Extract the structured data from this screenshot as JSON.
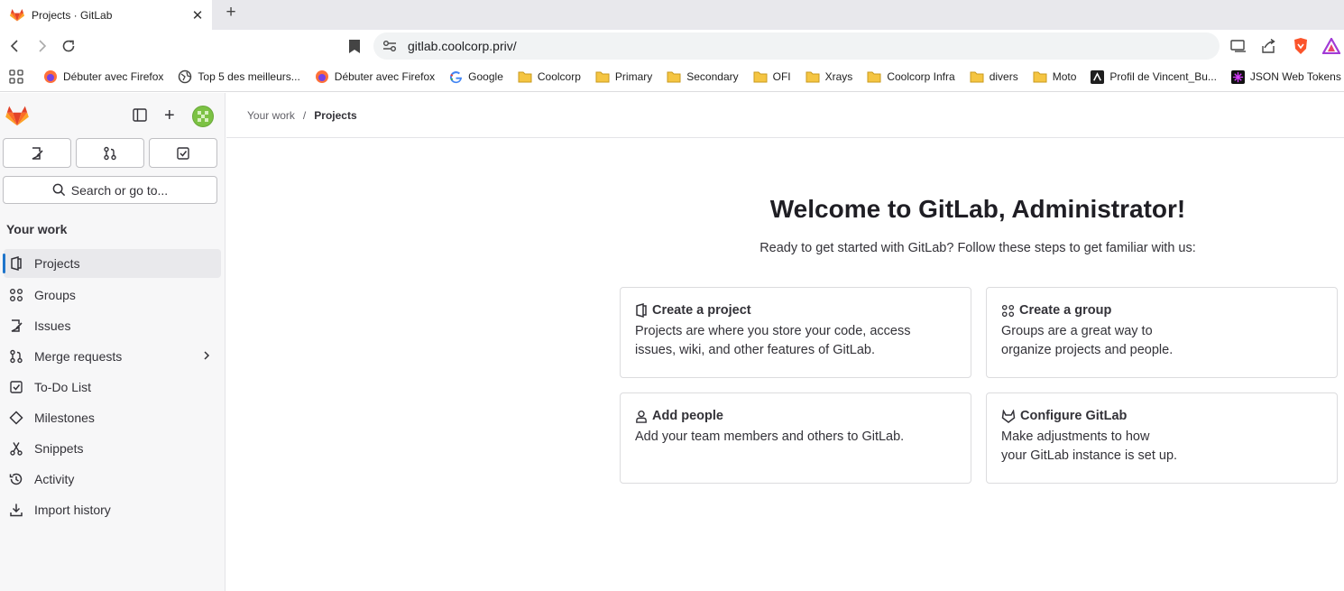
{
  "browser": {
    "tab_title": "Projects · GitLab",
    "tab_close": "✕",
    "new_tab": "+",
    "url": "gitlab.coolcorp.priv/"
  },
  "bookmarks": [
    {
      "label": "Débuter avec Firefox",
      "icon": "firefox-icon"
    },
    {
      "label": "Top 5 des meilleurs...",
      "icon": "globe-icon"
    },
    {
      "label": "Débuter avec Firefox",
      "icon": "firefox-icon"
    },
    {
      "label": "Google",
      "icon": "google-icon"
    },
    {
      "label": "Coolcorp",
      "icon": "folder-icon"
    },
    {
      "label": "Primary",
      "icon": "folder-icon"
    },
    {
      "label": "Secondary",
      "icon": "folder-icon"
    },
    {
      "label": "OFI",
      "icon": "folder-icon"
    },
    {
      "label": "Xrays",
      "icon": "folder-icon"
    },
    {
      "label": "Coolcorp Infra",
      "icon": "folder-icon"
    },
    {
      "label": "divers",
      "icon": "folder-icon"
    },
    {
      "label": "Moto",
      "icon": "folder-icon"
    },
    {
      "label": "Profil de Vincent_Bu...",
      "icon": "profile-icon"
    },
    {
      "label": "JSON Web Tokens",
      "icon": "jwt-icon"
    }
  ],
  "sidebar": {
    "search_label": "Search or go to...",
    "section_heading": "Your work",
    "items": [
      {
        "label": "Projects",
        "icon": "project-icon",
        "active": true
      },
      {
        "label": "Groups",
        "icon": "group-icon"
      },
      {
        "label": "Issues",
        "icon": "issues-icon"
      },
      {
        "label": "Merge requests",
        "icon": "merge-request-icon",
        "has_chevron": true
      },
      {
        "label": "To-Do List",
        "icon": "todo-icon"
      },
      {
        "label": "Milestones",
        "icon": "milestone-icon"
      },
      {
        "label": "Snippets",
        "icon": "snippet-icon"
      },
      {
        "label": "Activity",
        "icon": "activity-icon"
      },
      {
        "label": "Import history",
        "icon": "import-icon"
      }
    ]
  },
  "breadcrumb": {
    "parent": "Your work",
    "separator": "/",
    "current": "Projects"
  },
  "welcome": {
    "title": "Welcome to GitLab, Administrator!",
    "subtitle": "Ready to get started with GitLab? Follow these steps to get familiar with us:"
  },
  "cards": [
    {
      "title": "Create a project",
      "desc1": "Projects are where you store your code, access",
      "desc2": "issues, wiki, and other features of GitLab."
    },
    {
      "title": "Create a group",
      "desc1": "Groups are a great way to",
      "desc2": "organize projects and people."
    },
    {
      "title": "Add people",
      "desc1": "Add your team members and others to GitLab.",
      "desc2": ""
    },
    {
      "title": "Configure GitLab",
      "desc1": "Make adjustments to how",
      "desc2": "your GitLab instance is set up."
    }
  ],
  "colors": {
    "gitlab_orange": "#e24329",
    "active_indicator": "#1f75cb",
    "folder": "#f5c542"
  }
}
